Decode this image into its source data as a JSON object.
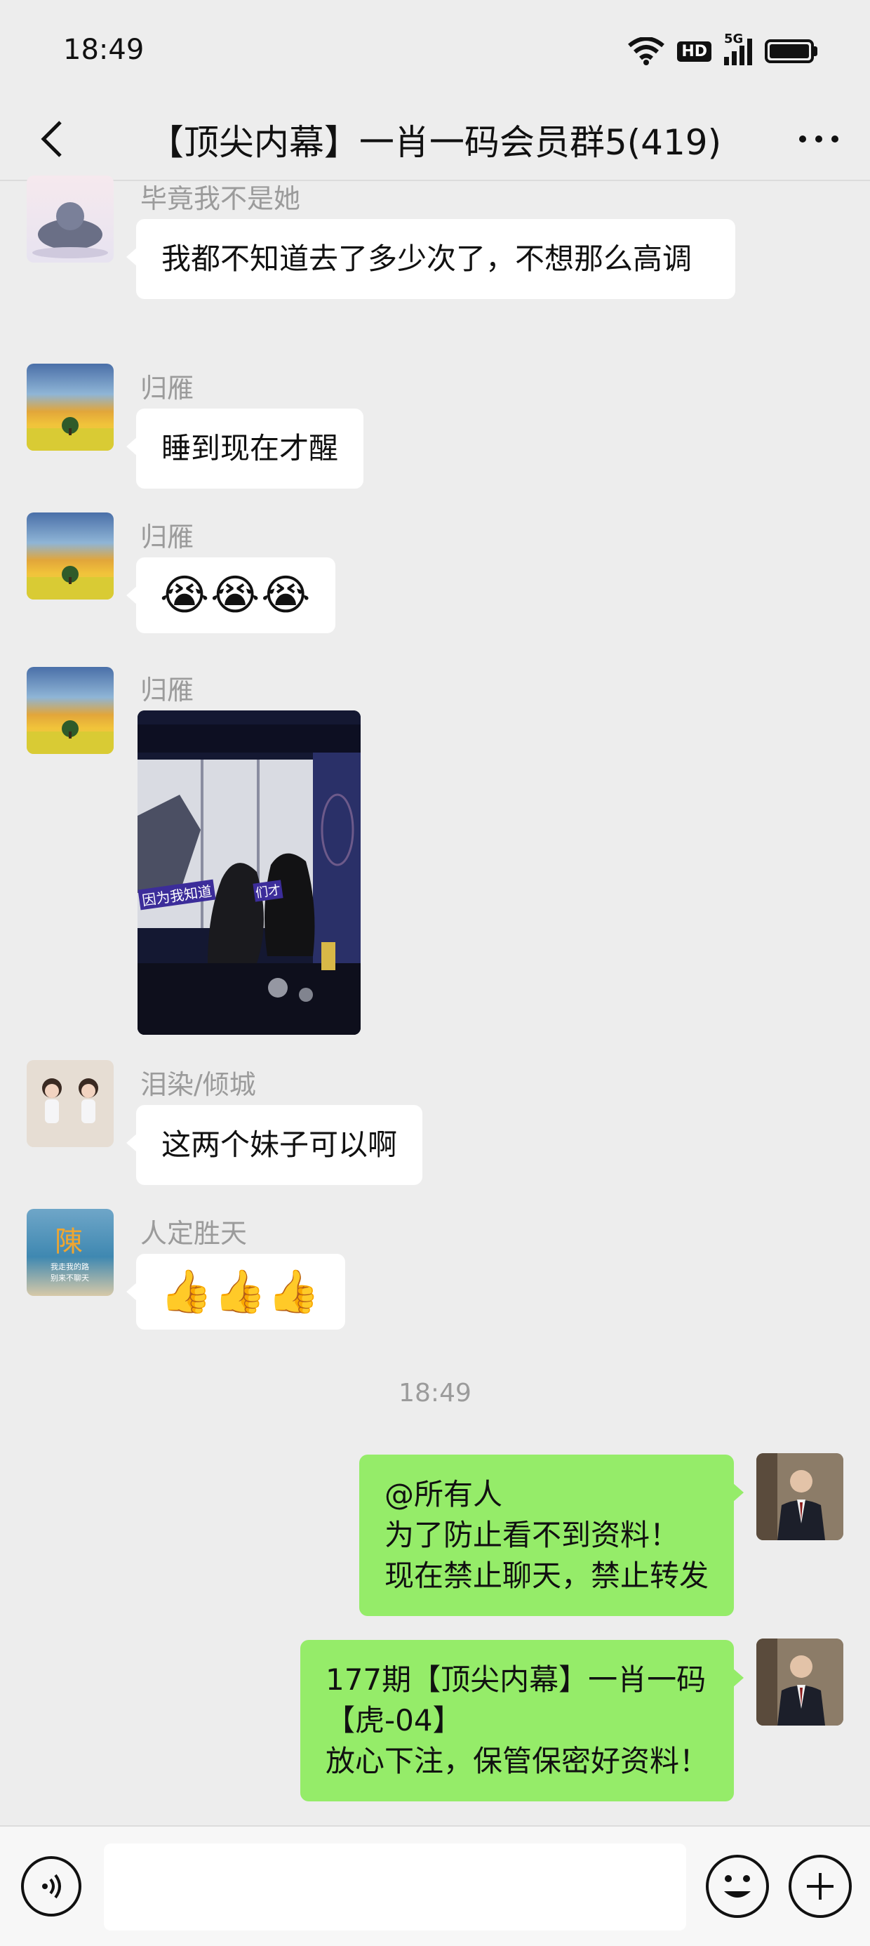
{
  "status_bar": {
    "time": "18:49",
    "network": "5G",
    "hd_badge": "HD"
  },
  "nav": {
    "title": "【顶尖内幕】一肖一码会员群5(419)"
  },
  "messages": [
    {
      "sender": "毕竟我不是她",
      "text": "我都不知道去了多少次了，不想那么高调"
    },
    {
      "sender": "归雁",
      "text": "睡到现在才醒"
    },
    {
      "sender": "归雁",
      "text": "😭😭😭"
    },
    {
      "sender": "归雁",
      "image_caption": "因为我知道",
      "image_caption_tail": "们才"
    },
    {
      "sender": "泪染/倾城",
      "text": "这两个妹子可以啊"
    },
    {
      "sender": "人定胜天",
      "text": "👍👍👍",
      "avatar_char": "陳",
      "avatar_sub1": "我走我的路",
      "avatar_sub2": "别来不聊天"
    }
  ],
  "timestamp": "18:49",
  "outgoing": [
    {
      "line1": "@所有人",
      "line2": "为了防止看不到资料！",
      "line3": "现在禁止聊天，禁止转发"
    },
    {
      "line1": "177期【顶尖内幕】一肖一码",
      "line2": "【虎-04】",
      "line3": "放心下注，保管保密好资料！"
    }
  ],
  "input": {
    "placeholder": ""
  },
  "colors": {
    "background": "#ededed",
    "bubble_out": "#95ec69",
    "bubble_in": "#ffffff"
  }
}
